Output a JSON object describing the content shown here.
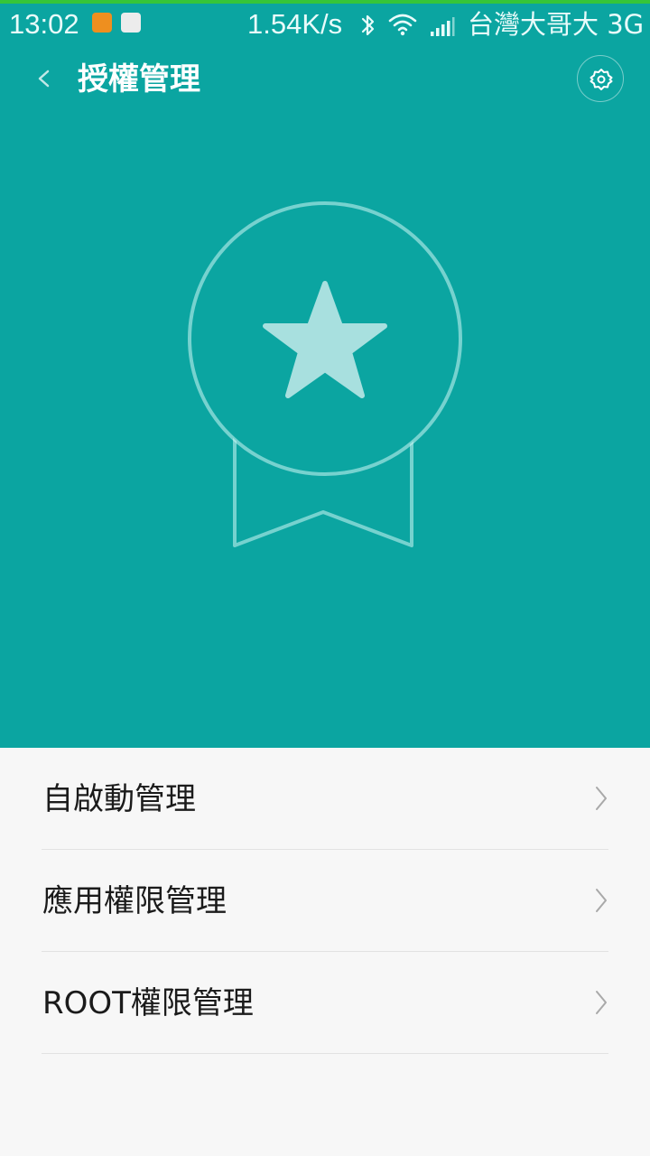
{
  "status_bar": {
    "time": "13:02",
    "network_speed": "1.54K/s",
    "carrier": "台灣大哥大 3G",
    "icons": [
      "notification-app-icon",
      "qualcomm-app-icon",
      "bluetooth-icon",
      "wifi-icon",
      "signal-icon"
    ]
  },
  "header": {
    "back_icon": "chevron-left-icon",
    "title": "授權管理",
    "settings_icon": "gear-icon"
  },
  "hero": {
    "illustration": "medal-star-icon",
    "background_color": "#0ba5a1",
    "star_color": "#a8e0df"
  },
  "menu": {
    "items": [
      {
        "label": "自啟動管理",
        "icon": "chevron-right-icon"
      },
      {
        "label": "應用權限管理",
        "icon": "chevron-right-icon"
      },
      {
        "label": "ROOT權限管理",
        "icon": "chevron-right-icon"
      }
    ]
  }
}
